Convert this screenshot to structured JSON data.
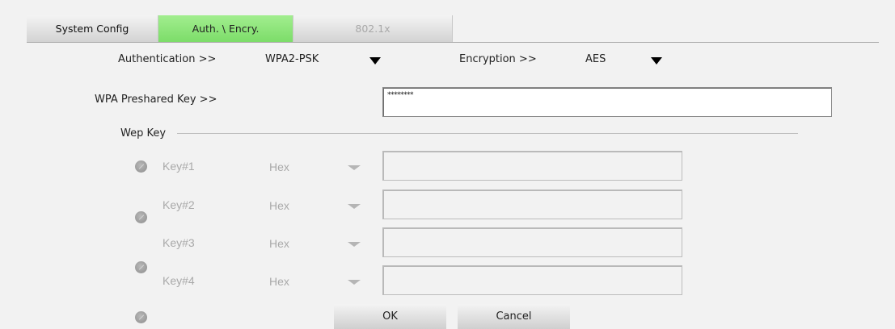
{
  "tabs": [
    {
      "label": "System Config",
      "state": "normal"
    },
    {
      "label": "Auth. \\ Encry.",
      "state": "active",
      "color": "#8ee57a"
    },
    {
      "label": "802.1x",
      "state": "disabled"
    }
  ],
  "auth": {
    "label": "Authentication >>",
    "value": "WPA2-PSK"
  },
  "encryption": {
    "label": "Encryption >>",
    "value": "AES"
  },
  "psk": {
    "label": "WPA Preshared Key >>",
    "value": "********"
  },
  "wep": {
    "legend": "Wep Key",
    "keys": [
      {
        "label": "Key#1",
        "format": "Hex",
        "value": ""
      },
      {
        "label": "Key#2",
        "format": "Hex",
        "value": ""
      },
      {
        "label": "Key#3",
        "format": "Hex",
        "value": ""
      },
      {
        "label": "Key#4",
        "format": "Hex",
        "value": ""
      }
    ]
  },
  "buttons": {
    "ok": "OK",
    "cancel": "Cancel"
  }
}
